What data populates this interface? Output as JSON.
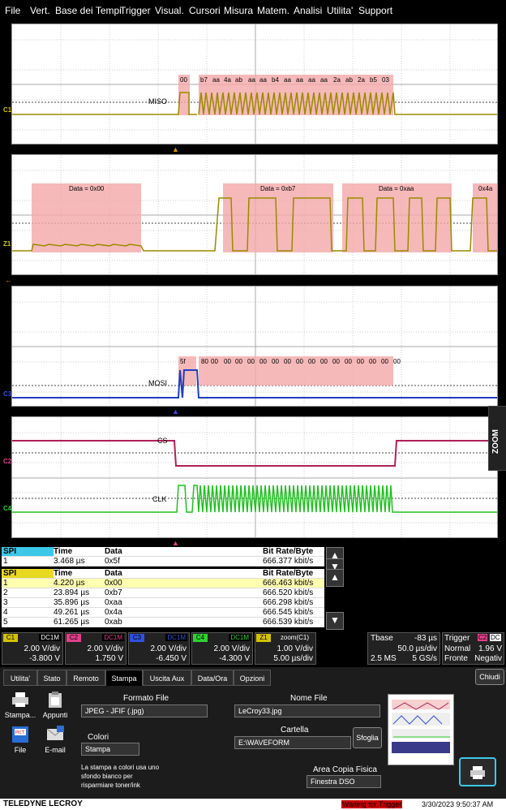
{
  "menu": [
    "File",
    "Vert.",
    "Base dei Tempi",
    "Trigger",
    "Visual.",
    "Cursori",
    "Misura",
    "Matem.",
    "Analisi",
    "Utilita'",
    "Support"
  ],
  "grid1": {
    "channel": "C1",
    "decode_label": "MISO",
    "bytes": [
      "00",
      "b7",
      "aa",
      "4a",
      "ab",
      "aa",
      "aa",
      "b4",
      "aa",
      "aa",
      "aa",
      "aa",
      "2a",
      "ab",
      "2a",
      "b5",
      "03"
    ]
  },
  "grid2": {
    "channel": "Z1",
    "boxes": [
      "Data = 0x00",
      "Data = 0xb7",
      "Data = 0xaa",
      "0x4a"
    ]
  },
  "grid3": {
    "channel": "C3",
    "decode_label": "MOSI",
    "bytes": [
      "5f",
      "80",
      "00",
      "00",
      "00",
      "00",
      "00",
      "00",
      "00",
      "00",
      "00",
      "00",
      "00",
      "00",
      "00",
      "00",
      "00",
      "00"
    ]
  },
  "grid4": {
    "channels": [
      "C2",
      "C4"
    ],
    "labels": [
      "CS",
      "CLK"
    ]
  },
  "zoom_tab": "ZOOM",
  "table1": {
    "headers": [
      "SPI",
      "Time",
      "Data",
      "Bit Rate/Byte"
    ],
    "rows": [
      [
        "1",
        "3.468 µs",
        "0x5f",
        "666.377 kbit/s"
      ]
    ]
  },
  "table2": {
    "headers": [
      "SPI",
      "Time",
      "Data",
      "Bit Rate/Byte"
    ],
    "rows": [
      [
        "1",
        "4.220 µs",
        "0x00",
        "666.463 kbit/s"
      ],
      [
        "2",
        "23.894 µs",
        "0xb7",
        "666.520 kbit/s"
      ],
      [
        "3",
        "35.896 µs",
        "0xaa",
        "666.298 kbit/s"
      ],
      [
        "4",
        "49.261 µs",
        "0x4a",
        "666.545 kbit/s"
      ],
      [
        "5",
        "61.265 µs",
        "0xab",
        "666.539 kbit/s"
      ]
    ]
  },
  "channels": [
    {
      "tag": "C1",
      "coupling": "DC1M",
      "vdiv": "2.00 V/div",
      "offset": "-3.800 V",
      "color": "#d4c200"
    },
    {
      "tag": "C2",
      "coupling": "DC1M",
      "vdiv": "2.00 V/div",
      "offset": "1.750 V",
      "color": "#e0408a"
    },
    {
      "tag": "C3",
      "coupling": "DC1M",
      "vdiv": "2.00 V/div",
      "offset": "-6.450 V",
      "color": "#3050e0"
    },
    {
      "tag": "C4",
      "coupling": "DC1M",
      "vdiv": "2.00 V/div",
      "offset": "-4.300 V",
      "color": "#30d030"
    },
    {
      "tag": "Z1",
      "coupling": "zoom(C1)",
      "vdiv": "1.00 V/div",
      "offset": "5.00 µs/div",
      "color": "#d4c200"
    }
  ],
  "timebase": {
    "label": "Tbase",
    "offset": "-83 µs",
    "tdiv": "50.0 µs/div",
    "samples": "2.5 MS",
    "rate": "5 GS/s"
  },
  "trigger": {
    "label": "Trigger",
    "source": "C2",
    "coupling": "DC",
    "mode": "Normal",
    "level": "1.96 V",
    "type": "Fronte",
    "slope": "Negativ"
  },
  "tabs": [
    "Utilita'",
    "Stato",
    "Remoto",
    "Stampa",
    "Uscita Aux",
    "Data/Ora",
    "Opzioni"
  ],
  "close_label": "Chiudi",
  "side_buttons": [
    "Stampa...",
    "Appunti",
    "File",
    "E-mail"
  ],
  "form": {
    "format_label": "Formato File",
    "format_value": "JPEG - JFIF (.jpg)",
    "colors_label": "Colori",
    "colors_value": "Stampa",
    "color_note": "La stampa a colori usa uno sfondo bianco per risparmiare toner/ink",
    "filename_label": "Nome File",
    "filename_value": "LeCroy33.jpg",
    "folder_label": "Cartella",
    "folder_value": "E:\\WAVEFORM",
    "browse_label": "Sfoglia",
    "area_label": "Area Copia Fisica",
    "area_value": "Finestra DSO"
  },
  "footer": {
    "brand": "TELEDYNE LECROY",
    "status": "Waiting for Trigger",
    "datetime": "3/30/2023 9:50:37 AM"
  }
}
